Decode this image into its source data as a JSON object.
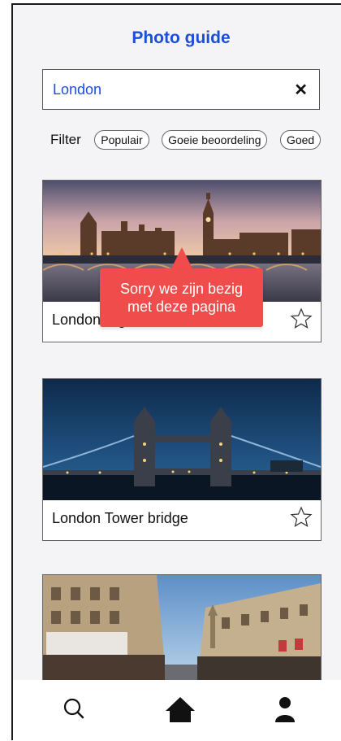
{
  "header": {
    "title": "Photo guide"
  },
  "search": {
    "value": "London",
    "clear_glyph": "✕"
  },
  "filter": {
    "label": "Filter",
    "chips": [
      "Populair",
      "Goeie beoordeling",
      "Goed"
    ]
  },
  "cards": [
    {
      "caption": "London Big Ben",
      "photo": "big-ben-westminster-sunset",
      "favorite": false
    },
    {
      "caption": "London Tower bridge",
      "photo": "tower-bridge-night",
      "favorite": false
    },
    {
      "caption": "",
      "photo": "regent-street-curve",
      "favorite": false
    }
  ],
  "tooltip": {
    "line1": "Sorry we zijn bezig",
    "line2": "met deze pagina"
  },
  "bottom_nav": {
    "items": [
      "search-icon",
      "home-icon",
      "user-icon"
    ]
  },
  "colors": {
    "accent": "#1a4fd8",
    "tooltip": "#f14c4c",
    "background": "#f4f4f6"
  }
}
